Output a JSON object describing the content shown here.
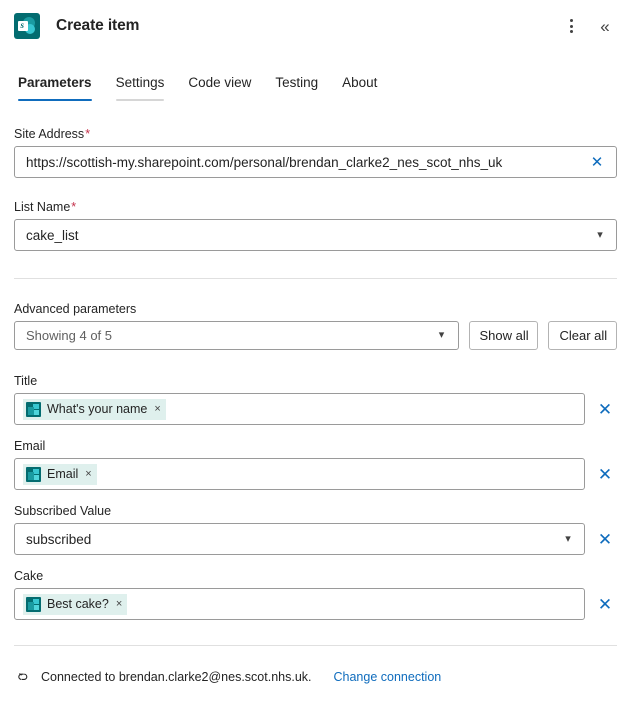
{
  "header": {
    "app_icon": "sharepoint-icon",
    "title": "Create item",
    "more_icon": "more-vertical-icon",
    "collapse_icon": "double-chevron-left-icon"
  },
  "tabs": [
    {
      "label": "Parameters",
      "active": true,
      "hovered": false
    },
    {
      "label": "Settings",
      "active": false,
      "hovered": true
    },
    {
      "label": "Code view",
      "active": false,
      "hovered": false
    },
    {
      "label": "Testing",
      "active": false,
      "hovered": false
    },
    {
      "label": "About",
      "active": false,
      "hovered": false
    }
  ],
  "fields": {
    "site_address": {
      "label": "Site Address",
      "required": "*",
      "value": "https://scottish-my.sharepoint.com/personal/brendan_clarke2_nes_scot_nhs_uk",
      "clear_icon": "close-icon"
    },
    "list_name": {
      "label": "List Name",
      "required": "*",
      "value": "cake_list",
      "chevron_icon": "chevron-down-icon"
    }
  },
  "advanced": {
    "label": "Advanced parameters",
    "select_value": "Showing 4 of 5",
    "chevron_icon": "chevron-down-icon",
    "show_all_label": "Show all",
    "clear_all_label": "Clear all"
  },
  "parameters": [
    {
      "label": "Title",
      "type": "token",
      "token": "What's your name",
      "token_icon": "forms-icon",
      "token_remove_icon": "times-icon",
      "clear_icon": "close-icon"
    },
    {
      "label": "Email",
      "type": "token",
      "token": "Email",
      "token_icon": "forms-icon",
      "token_remove_icon": "times-icon",
      "clear_icon": "close-icon"
    },
    {
      "label": "Subscribed Value",
      "type": "dropdown",
      "value": "subscribed",
      "chevron_icon": "chevron-down-icon",
      "clear_icon": "close-icon"
    },
    {
      "label": "Cake",
      "type": "token",
      "token": "Best cake?",
      "token_icon": "forms-icon",
      "token_remove_icon": "times-icon",
      "clear_icon": "close-icon"
    }
  ],
  "footer": {
    "icon": "connection-link-icon",
    "connected_text": "Connected to brendan.clarke2@nes.scot.nhs.uk.",
    "change_link": "Change connection"
  },
  "colors": {
    "accent_blue": "#0f6cbd",
    "required_red": "#c4314b",
    "sharepoint_teal": "#036c70",
    "chip_bg": "#dff0ed",
    "border_gray": "#9a9a9a"
  }
}
